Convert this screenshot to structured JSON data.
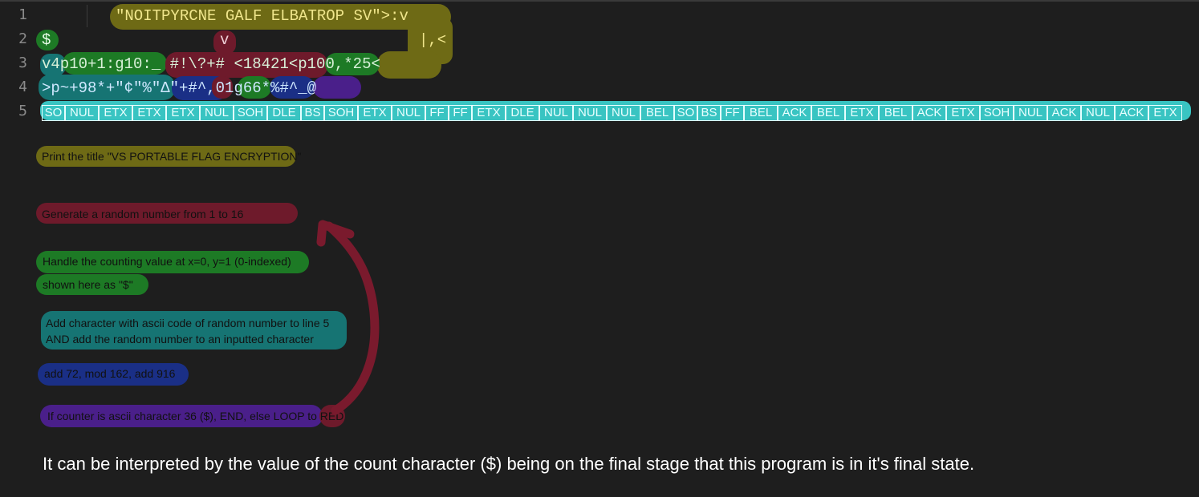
{
  "line_numbers": [
    "1",
    "2",
    "3",
    "4",
    "5"
  ],
  "code": {
    "line1": "\"NOITPYRCNE GALF ELBATROP SV\">:v",
    "line2_dollar": "$",
    "line2_v": "v",
    "line2_end": "|,<",
    "line3": "v4p10+1:g10:_ #!\\?+# <18421<p100,*25<",
    "line4": ">p~+98*+\"¢\"%\"Δ\"+#^,01g66*%#^_@",
    "line5_tokens": [
      "SO",
      "NUL",
      "ETX",
      "ETX",
      "ETX",
      "NUL",
      "SOH",
      "DLE",
      "BS",
      "SOH",
      "ETX",
      "NUL",
      "FF",
      "FF",
      "ETX",
      "DLE",
      "NUL",
      "NUL",
      "NUL",
      "BEL",
      "SO",
      "BS",
      "FF",
      "BEL",
      "ACK",
      "BEL",
      "ETX",
      "BEL",
      "ACK",
      "ETX",
      "SOH",
      "NUL",
      "ACK",
      "NUL",
      "ACK",
      "ETX"
    ]
  },
  "notes": {
    "yellow": "Print the title \"VS PORTABLE FLAG ENCRYPTION\"",
    "red": "Generate a random number from 1 to 16",
    "green1": "Handle the counting value at x=0, y=1 (0-indexed)",
    "green2": "shown here as \"$\"",
    "teal1": "Add character with ascii code of random number to line 5",
    "teal2": "AND add the random number to an inputted character",
    "blue": "add 72, mod 162, add 916",
    "purple": "If counter is ascii character 36 ($), END, else LOOP to RED"
  },
  "footer": "It can be interpreted by the value of the count character ($) being on the final stage that this program is in it's final state.",
  "colors": {
    "background": "#1e1e1e",
    "yellow": "#6e6a15",
    "red": "#6e1a2b",
    "green": "#1d7a25",
    "teal": "#167473",
    "blue": "#1a2f86",
    "purple": "#4a1f8a",
    "cyan": "#39c4c2",
    "arrow": "#7a1a2d"
  }
}
